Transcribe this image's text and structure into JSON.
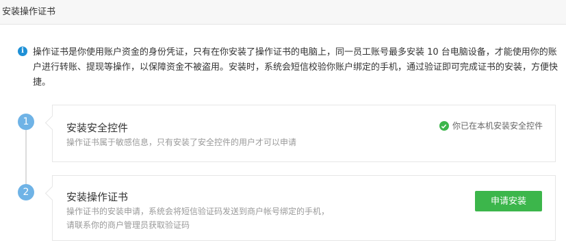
{
  "header": {
    "title": "安装操作证书"
  },
  "notice": {
    "icon": "info-icon",
    "text": "操作证书是你使用账户资金的身份凭证，只有在你安装了操作证书的电脑上，同一员工账号最多安装 10 台电脑设备，才能使用你的账户进行转账、提现等操作，以保障资金不被盗用。安装时，系统会短信校验你账户绑定的手机，通过验证即可完成证书的安装，方便快捷。"
  },
  "steps": [
    {
      "number": "1",
      "title": "安装安全控件",
      "description": "操作证书属于敏感信息，只有安装了安全控件的用户才可以申请",
      "status_text": "你已在本机安装安全控件",
      "status_icon": "check-circle-icon",
      "status_color": "#3cb64b"
    },
    {
      "number": "2",
      "title": "安装操作证书",
      "description_line1": "操作证书的安装申请，系统会将短信验证码发送到商户帐号绑定的手机，",
      "description_line2": "请联系你的商户管理员获取验证码",
      "button_label": "申请安装",
      "button_color": "#3cb64b"
    }
  ],
  "colors": {
    "step_circle": "#6fb3e6",
    "info_icon": "#1e90d6",
    "header_bg": "#f7f7f7"
  }
}
